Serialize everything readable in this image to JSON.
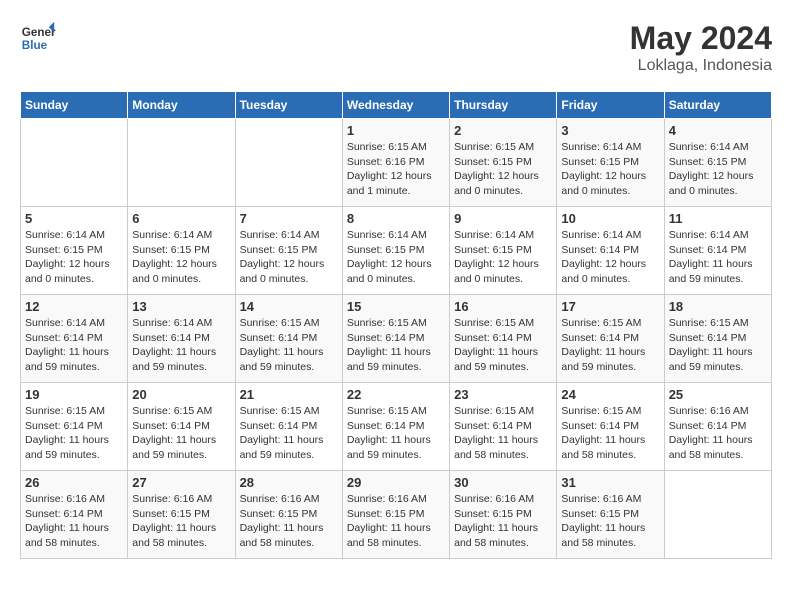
{
  "header": {
    "logo_line1": "General",
    "logo_line2": "Blue",
    "title": "May 2024",
    "subtitle": "Loklaga, Indonesia"
  },
  "days_of_week": [
    "Sunday",
    "Monday",
    "Tuesday",
    "Wednesday",
    "Thursday",
    "Friday",
    "Saturday"
  ],
  "weeks": [
    [
      {
        "day": "",
        "info": ""
      },
      {
        "day": "",
        "info": ""
      },
      {
        "day": "",
        "info": ""
      },
      {
        "day": "1",
        "info": "Sunrise: 6:15 AM\nSunset: 6:16 PM\nDaylight: 12 hours\nand 1 minute."
      },
      {
        "day": "2",
        "info": "Sunrise: 6:15 AM\nSunset: 6:15 PM\nDaylight: 12 hours\nand 0 minutes."
      },
      {
        "day": "3",
        "info": "Sunrise: 6:14 AM\nSunset: 6:15 PM\nDaylight: 12 hours\nand 0 minutes."
      },
      {
        "day": "4",
        "info": "Sunrise: 6:14 AM\nSunset: 6:15 PM\nDaylight: 12 hours\nand 0 minutes."
      }
    ],
    [
      {
        "day": "5",
        "info": "Sunrise: 6:14 AM\nSunset: 6:15 PM\nDaylight: 12 hours\nand 0 minutes."
      },
      {
        "day": "6",
        "info": "Sunrise: 6:14 AM\nSunset: 6:15 PM\nDaylight: 12 hours\nand 0 minutes."
      },
      {
        "day": "7",
        "info": "Sunrise: 6:14 AM\nSunset: 6:15 PM\nDaylight: 12 hours\nand 0 minutes."
      },
      {
        "day": "8",
        "info": "Sunrise: 6:14 AM\nSunset: 6:15 PM\nDaylight: 12 hours\nand 0 minutes."
      },
      {
        "day": "9",
        "info": "Sunrise: 6:14 AM\nSunset: 6:15 PM\nDaylight: 12 hours\nand 0 minutes."
      },
      {
        "day": "10",
        "info": "Sunrise: 6:14 AM\nSunset: 6:14 PM\nDaylight: 12 hours\nand 0 minutes."
      },
      {
        "day": "11",
        "info": "Sunrise: 6:14 AM\nSunset: 6:14 PM\nDaylight: 11 hours\nand 59 minutes."
      }
    ],
    [
      {
        "day": "12",
        "info": "Sunrise: 6:14 AM\nSunset: 6:14 PM\nDaylight: 11 hours\nand 59 minutes."
      },
      {
        "day": "13",
        "info": "Sunrise: 6:14 AM\nSunset: 6:14 PM\nDaylight: 11 hours\nand 59 minutes."
      },
      {
        "day": "14",
        "info": "Sunrise: 6:15 AM\nSunset: 6:14 PM\nDaylight: 11 hours\nand 59 minutes."
      },
      {
        "day": "15",
        "info": "Sunrise: 6:15 AM\nSunset: 6:14 PM\nDaylight: 11 hours\nand 59 minutes."
      },
      {
        "day": "16",
        "info": "Sunrise: 6:15 AM\nSunset: 6:14 PM\nDaylight: 11 hours\nand 59 minutes."
      },
      {
        "day": "17",
        "info": "Sunrise: 6:15 AM\nSunset: 6:14 PM\nDaylight: 11 hours\nand 59 minutes."
      },
      {
        "day": "18",
        "info": "Sunrise: 6:15 AM\nSunset: 6:14 PM\nDaylight: 11 hours\nand 59 minutes."
      }
    ],
    [
      {
        "day": "19",
        "info": "Sunrise: 6:15 AM\nSunset: 6:14 PM\nDaylight: 11 hours\nand 59 minutes."
      },
      {
        "day": "20",
        "info": "Sunrise: 6:15 AM\nSunset: 6:14 PM\nDaylight: 11 hours\nand 59 minutes."
      },
      {
        "day": "21",
        "info": "Sunrise: 6:15 AM\nSunset: 6:14 PM\nDaylight: 11 hours\nand 59 minutes."
      },
      {
        "day": "22",
        "info": "Sunrise: 6:15 AM\nSunset: 6:14 PM\nDaylight: 11 hours\nand 59 minutes."
      },
      {
        "day": "23",
        "info": "Sunrise: 6:15 AM\nSunset: 6:14 PM\nDaylight: 11 hours\nand 58 minutes."
      },
      {
        "day": "24",
        "info": "Sunrise: 6:15 AM\nSunset: 6:14 PM\nDaylight: 11 hours\nand 58 minutes."
      },
      {
        "day": "25",
        "info": "Sunrise: 6:16 AM\nSunset: 6:14 PM\nDaylight: 11 hours\nand 58 minutes."
      }
    ],
    [
      {
        "day": "26",
        "info": "Sunrise: 6:16 AM\nSunset: 6:14 PM\nDaylight: 11 hours\nand 58 minutes."
      },
      {
        "day": "27",
        "info": "Sunrise: 6:16 AM\nSunset: 6:15 PM\nDaylight: 11 hours\nand 58 minutes."
      },
      {
        "day": "28",
        "info": "Sunrise: 6:16 AM\nSunset: 6:15 PM\nDaylight: 11 hours\nand 58 minutes."
      },
      {
        "day": "29",
        "info": "Sunrise: 6:16 AM\nSunset: 6:15 PM\nDaylight: 11 hours\nand 58 minutes."
      },
      {
        "day": "30",
        "info": "Sunrise: 6:16 AM\nSunset: 6:15 PM\nDaylight: 11 hours\nand 58 minutes."
      },
      {
        "day": "31",
        "info": "Sunrise: 6:16 AM\nSunset: 6:15 PM\nDaylight: 11 hours\nand 58 minutes."
      },
      {
        "day": "",
        "info": ""
      }
    ]
  ]
}
